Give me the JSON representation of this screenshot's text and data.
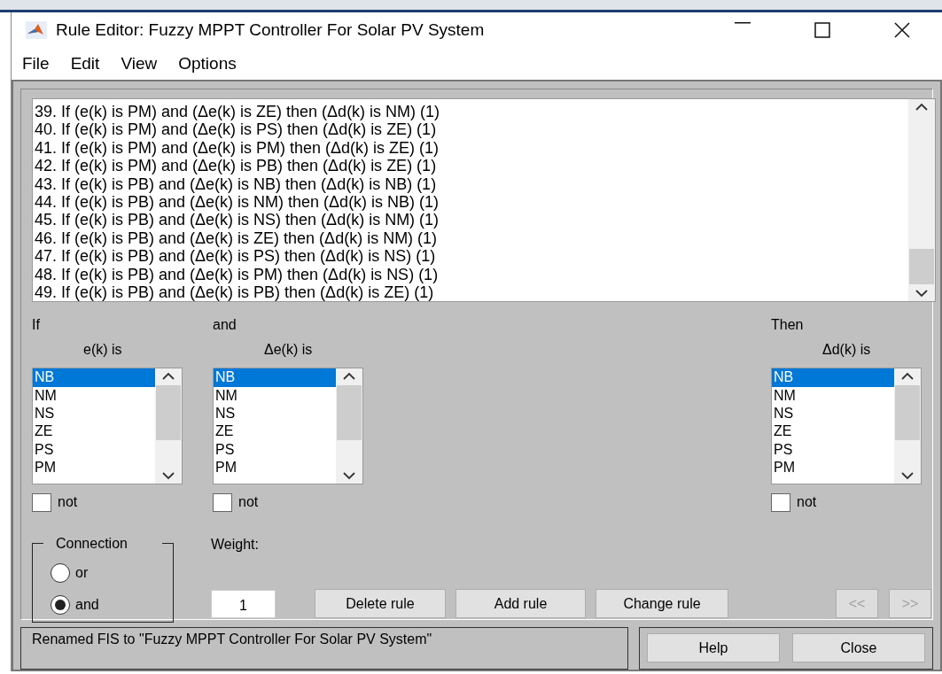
{
  "window": {
    "title": "Rule Editor: Fuzzy MPPT Controller For Solar PV System"
  },
  "menu": [
    "File",
    "Edit",
    "View",
    "Options"
  ],
  "rules": [
    "39. If (e(k) is PM) and (Δe(k) is ZE) then (Δd(k) is NM) (1)",
    "40. If (e(k) is PM) and (Δe(k) is PS) then (Δd(k) is ZE) (1)",
    "41. If (e(k) is PM) and (Δe(k) is PM) then (Δd(k) is ZE) (1)",
    "42. If (e(k) is PM) and (Δe(k) is PB) then (Δd(k) is ZE) (1)",
    "43. If (e(k) is PB) and (Δe(k) is NB) then (Δd(k) is NB) (1)",
    "44. If (e(k) is PB) and (Δe(k) is NM) then (Δd(k) is NB) (1)",
    "45. If (e(k) is PB) and (Δe(k) is NS) then (Δd(k) is NM) (1)",
    "46. If (e(k) is PB) and (Δe(k) is ZE) then (Δd(k) is NM) (1)",
    "47. If (e(k) is PB) and (Δe(k) is PS) then (Δd(k) is NS) (1)",
    "48. If (e(k) is PB) and (Δe(k) is PM) then (Δd(k) is NS) (1)",
    "49. If (e(k) is PB) and (Δe(k) is PB) then (Δd(k) is ZE) (1)"
  ],
  "variables": [
    {
      "kind": "input",
      "heading": "If",
      "caption": "e(k) is",
      "not_label": "not",
      "not": false,
      "options": [
        {
          "label": "NB",
          "selected": true
        },
        {
          "label": "NM",
          "selected": false
        },
        {
          "label": "NS",
          "selected": false
        },
        {
          "label": "ZE",
          "selected": false
        },
        {
          "label": "PS",
          "selected": false
        },
        {
          "label": "PM",
          "selected": false
        }
      ]
    },
    {
      "kind": "input",
      "heading": "and",
      "caption": "Δe(k) is",
      "not_label": "not",
      "not": false,
      "options": [
        {
          "label": "NB",
          "selected": true
        },
        {
          "label": "NM",
          "selected": false
        },
        {
          "label": "NS",
          "selected": false
        },
        {
          "label": "ZE",
          "selected": false
        },
        {
          "label": "PS",
          "selected": false
        },
        {
          "label": "PM",
          "selected": false
        }
      ]
    },
    {
      "kind": "output",
      "heading": "Then",
      "caption": "Δd(k) is",
      "not_label": "not",
      "not": false,
      "options": [
        {
          "label": "NB",
          "selected": true
        },
        {
          "label": "NM",
          "selected": false
        },
        {
          "label": "NS",
          "selected": false
        },
        {
          "label": "ZE",
          "selected": false
        },
        {
          "label": "PS",
          "selected": false
        },
        {
          "label": "PM",
          "selected": false
        }
      ]
    }
  ],
  "connection": {
    "title": "Connection",
    "options": [
      {
        "label": "or",
        "selected": false
      },
      {
        "label": "and",
        "selected": true
      }
    ]
  },
  "weight": {
    "label": "Weight:",
    "value": "1"
  },
  "rule_buttons": [
    {
      "label": "Delete rule",
      "disabled": false
    },
    {
      "label": "Add rule",
      "disabled": false
    },
    {
      "label": "Change rule",
      "disabled": false
    }
  ],
  "nav_buttons": [
    {
      "label": "<<",
      "disabled": true
    },
    {
      "label": ">>",
      "disabled": true
    }
  ],
  "status_bar": "Renamed FIS to \"Fuzzy MPPT Controller For Solar PV System\"",
  "footer_buttons": [
    "Help",
    "Close"
  ]
}
